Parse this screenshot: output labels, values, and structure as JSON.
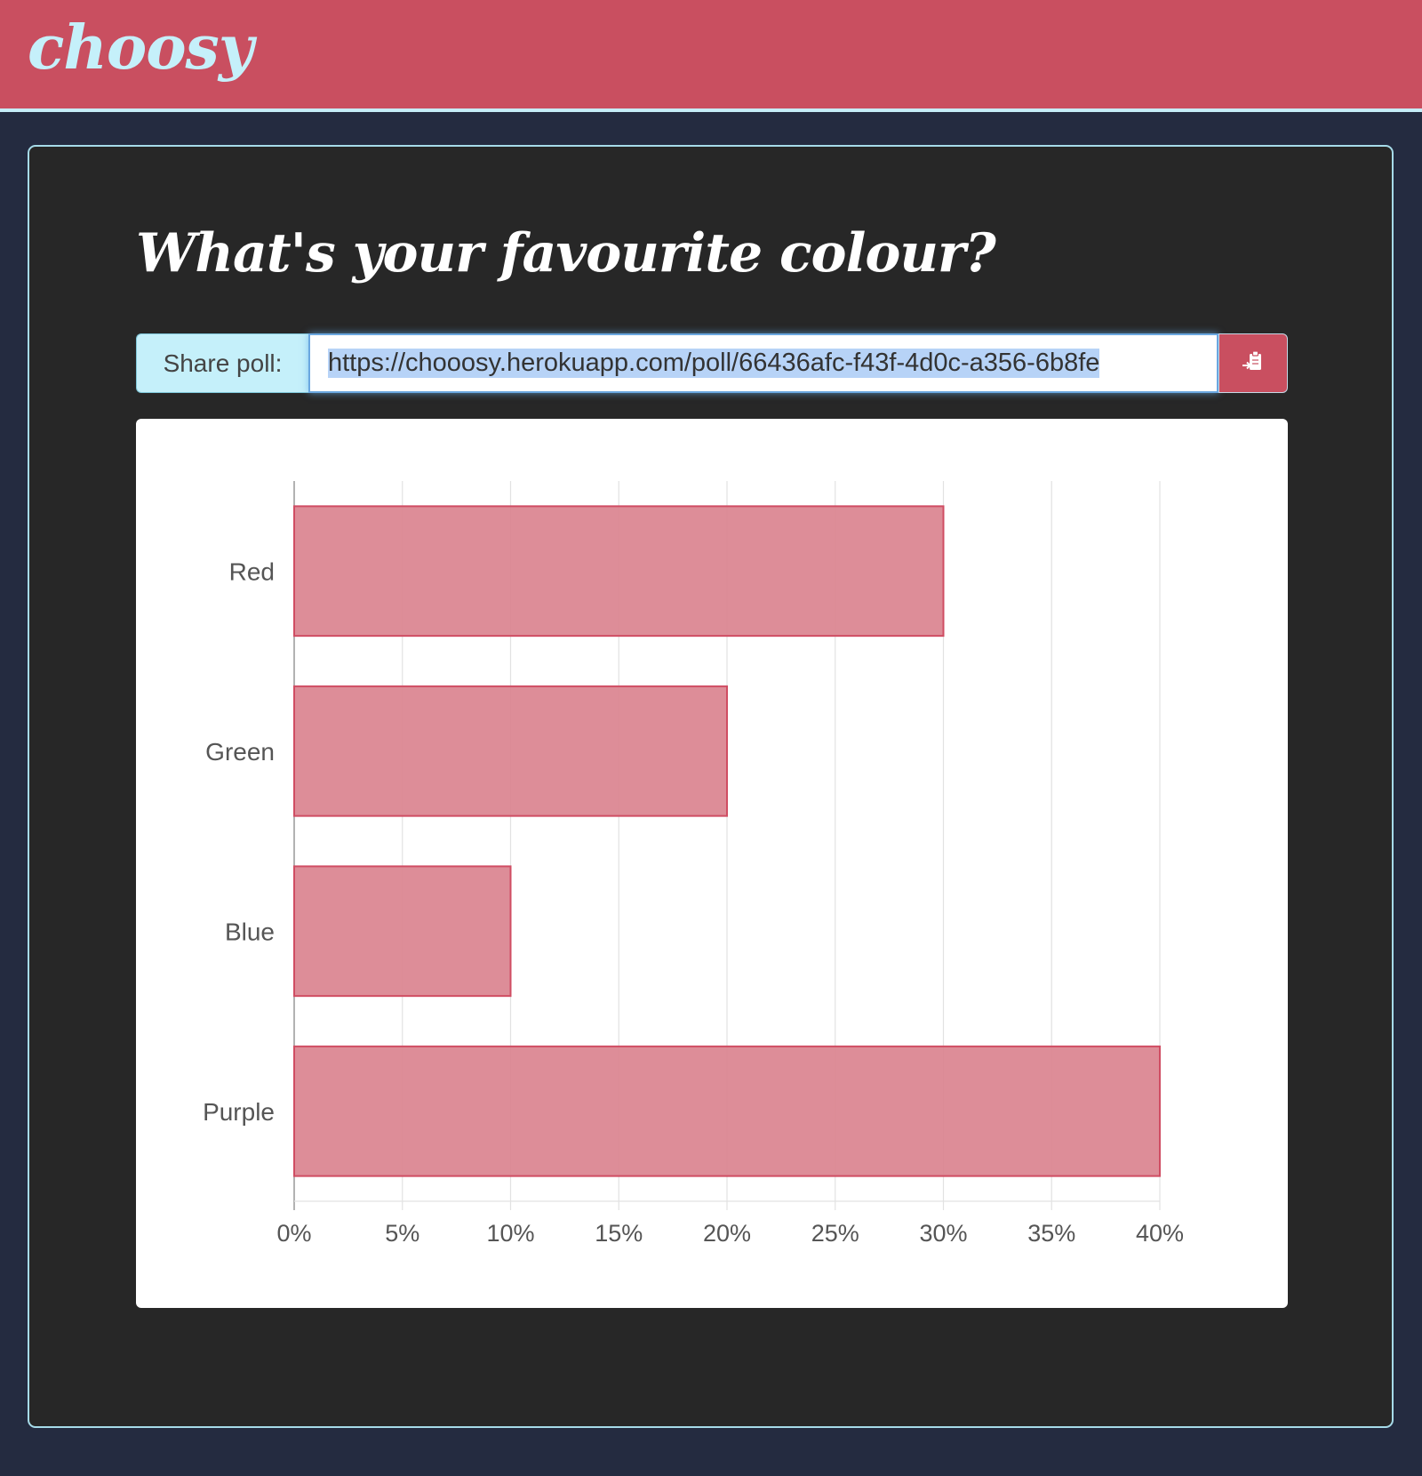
{
  "app": {
    "brand": "choosy"
  },
  "poll": {
    "question": "What's your favourite colour?"
  },
  "share": {
    "label": "Share poll:",
    "url": "https://chooosy.herokuapp.com/poll/66436afc-f43f-4d0c-a356-6b8fe",
    "copy_icon": "clipboard-paste-icon"
  },
  "colors": {
    "brand": "#c94f60",
    "brand_text": "#c5f0fa",
    "bar_fill": "#da838f",
    "bar_stroke": "#d04d63",
    "page_bg": "#242b40",
    "card_bg": "#272727"
  },
  "chart_data": {
    "type": "bar",
    "orientation": "horizontal",
    "categories": [
      "Red",
      "Green",
      "Blue",
      "Purple"
    ],
    "values": [
      30,
      20,
      10,
      40
    ],
    "xlim": [
      0,
      40
    ],
    "xticks": [
      "0%",
      "5%",
      "10%",
      "15%",
      "20%",
      "25%",
      "30%",
      "35%",
      "40%"
    ],
    "tick_values": [
      0,
      5,
      10,
      15,
      20,
      25,
      30,
      35,
      40
    ],
    "grid": true,
    "legend": "none"
  }
}
